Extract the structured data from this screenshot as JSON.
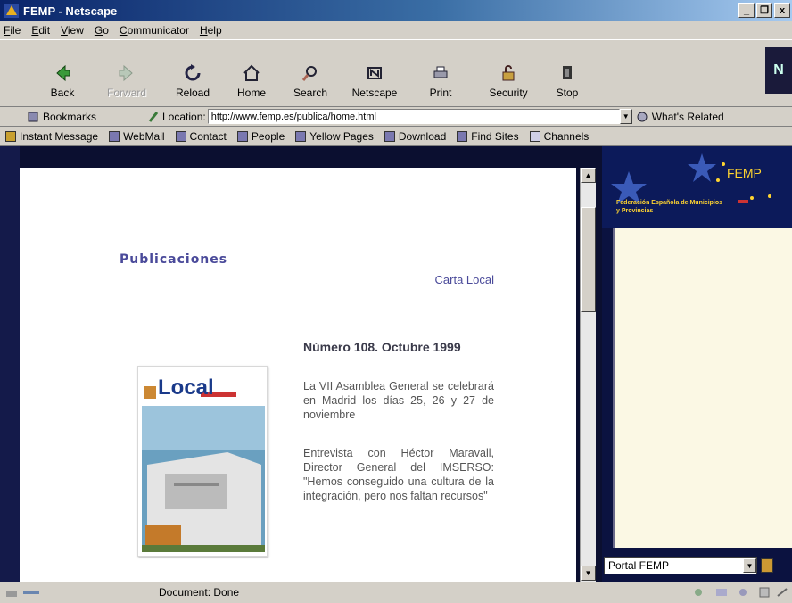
{
  "window": {
    "title": "FEMP - Netscape",
    "controls": [
      "_",
      "❐",
      "x"
    ]
  },
  "menu": [
    "File",
    "Edit",
    "View",
    "Go",
    "Communicator",
    "Help"
  ],
  "nav_buttons": [
    {
      "label": "Back",
      "icon": "back-arrow-icon",
      "enabled": true
    },
    {
      "label": "Forward",
      "icon": "forward-arrow-icon",
      "enabled": false
    },
    {
      "label": "Reload",
      "icon": "reload-icon",
      "enabled": true
    },
    {
      "label": "Home",
      "icon": "home-icon",
      "enabled": true
    },
    {
      "label": "Search",
      "icon": "search-icon",
      "enabled": true
    },
    {
      "label": "Netscape",
      "icon": "netscape-icon",
      "enabled": true
    },
    {
      "label": "Print",
      "icon": "print-icon",
      "enabled": true
    },
    {
      "label": "Security",
      "icon": "lock-icon",
      "enabled": true
    },
    {
      "label": "Stop",
      "icon": "stop-icon",
      "enabled": true
    }
  ],
  "logo_text": "N",
  "location": {
    "bookmarks_label": "Bookmarks",
    "location_label": "Location:",
    "url": "http://www.femp.es/publica/home.html",
    "whats_related": "What's Related"
  },
  "personal_toolbar": [
    "Instant Message",
    "WebMail",
    "Contact",
    "People",
    "Yellow Pages",
    "Download",
    "Find Sites",
    "Channels"
  ],
  "page": {
    "heading": "Publicaciones",
    "subheading": "Carta Local",
    "issue_title": "Número 108. Octubre 1999",
    "paragraphs": [
      "La VII Asamblea General se celebrará en Madrid los días 25, 26 y 27 de noviembre",
      "Entrevista con Héctor Maravall, Director General del IMSERSO: \"Hemos conseguido una cultura de la integración, pero nos faltan recursos\""
    ],
    "cover": {
      "title": "Local"
    }
  },
  "sidebar": {
    "title": "FEMP",
    "subtitle": "Federación Española de Municipios y Provincias",
    "select_value": "Portal FEMP"
  },
  "status": {
    "text": "Document: Done"
  },
  "colors": {
    "title_bar": "#0a246a",
    "chrome": "#d4d0c8",
    "heading": "#4a4a9a",
    "sidebar_bg": "#0b1240",
    "sidebar_panel": "#fbf8e4",
    "sidebar_title": "#ffd430"
  }
}
